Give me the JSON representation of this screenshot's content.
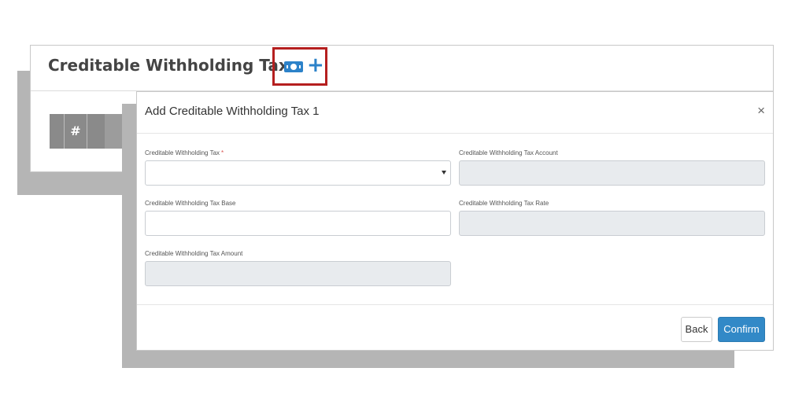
{
  "page": {
    "title": "Creditable Withholding Tax",
    "add_icon": "money-icon",
    "plus_icon": "plus-icon",
    "table_header": {
      "number_col": "#"
    }
  },
  "modal": {
    "title": "Add Creditable Withholding Tax 1",
    "close_glyph": "×",
    "fields": {
      "cwt": {
        "label": "Creditable Withholding Tax",
        "required_mark": "*",
        "value": ""
      },
      "cwt_account": {
        "label": "Creditable Withholding Tax Account",
        "value": ""
      },
      "cwt_base": {
        "label": "Creditable Withholding Tax Base",
        "value": ""
      },
      "cwt_rate": {
        "label": "Creditable Withholding Tax Rate",
        "value": ""
      },
      "cwt_amount": {
        "label": "Creditable Withholding Tax Amount",
        "value": ""
      }
    },
    "buttons": {
      "back": "Back",
      "confirm": "Confirm"
    }
  },
  "colors": {
    "accent": "#3289c7",
    "highlight": "#b51f1f",
    "disabled_field": "#e8ebee"
  }
}
